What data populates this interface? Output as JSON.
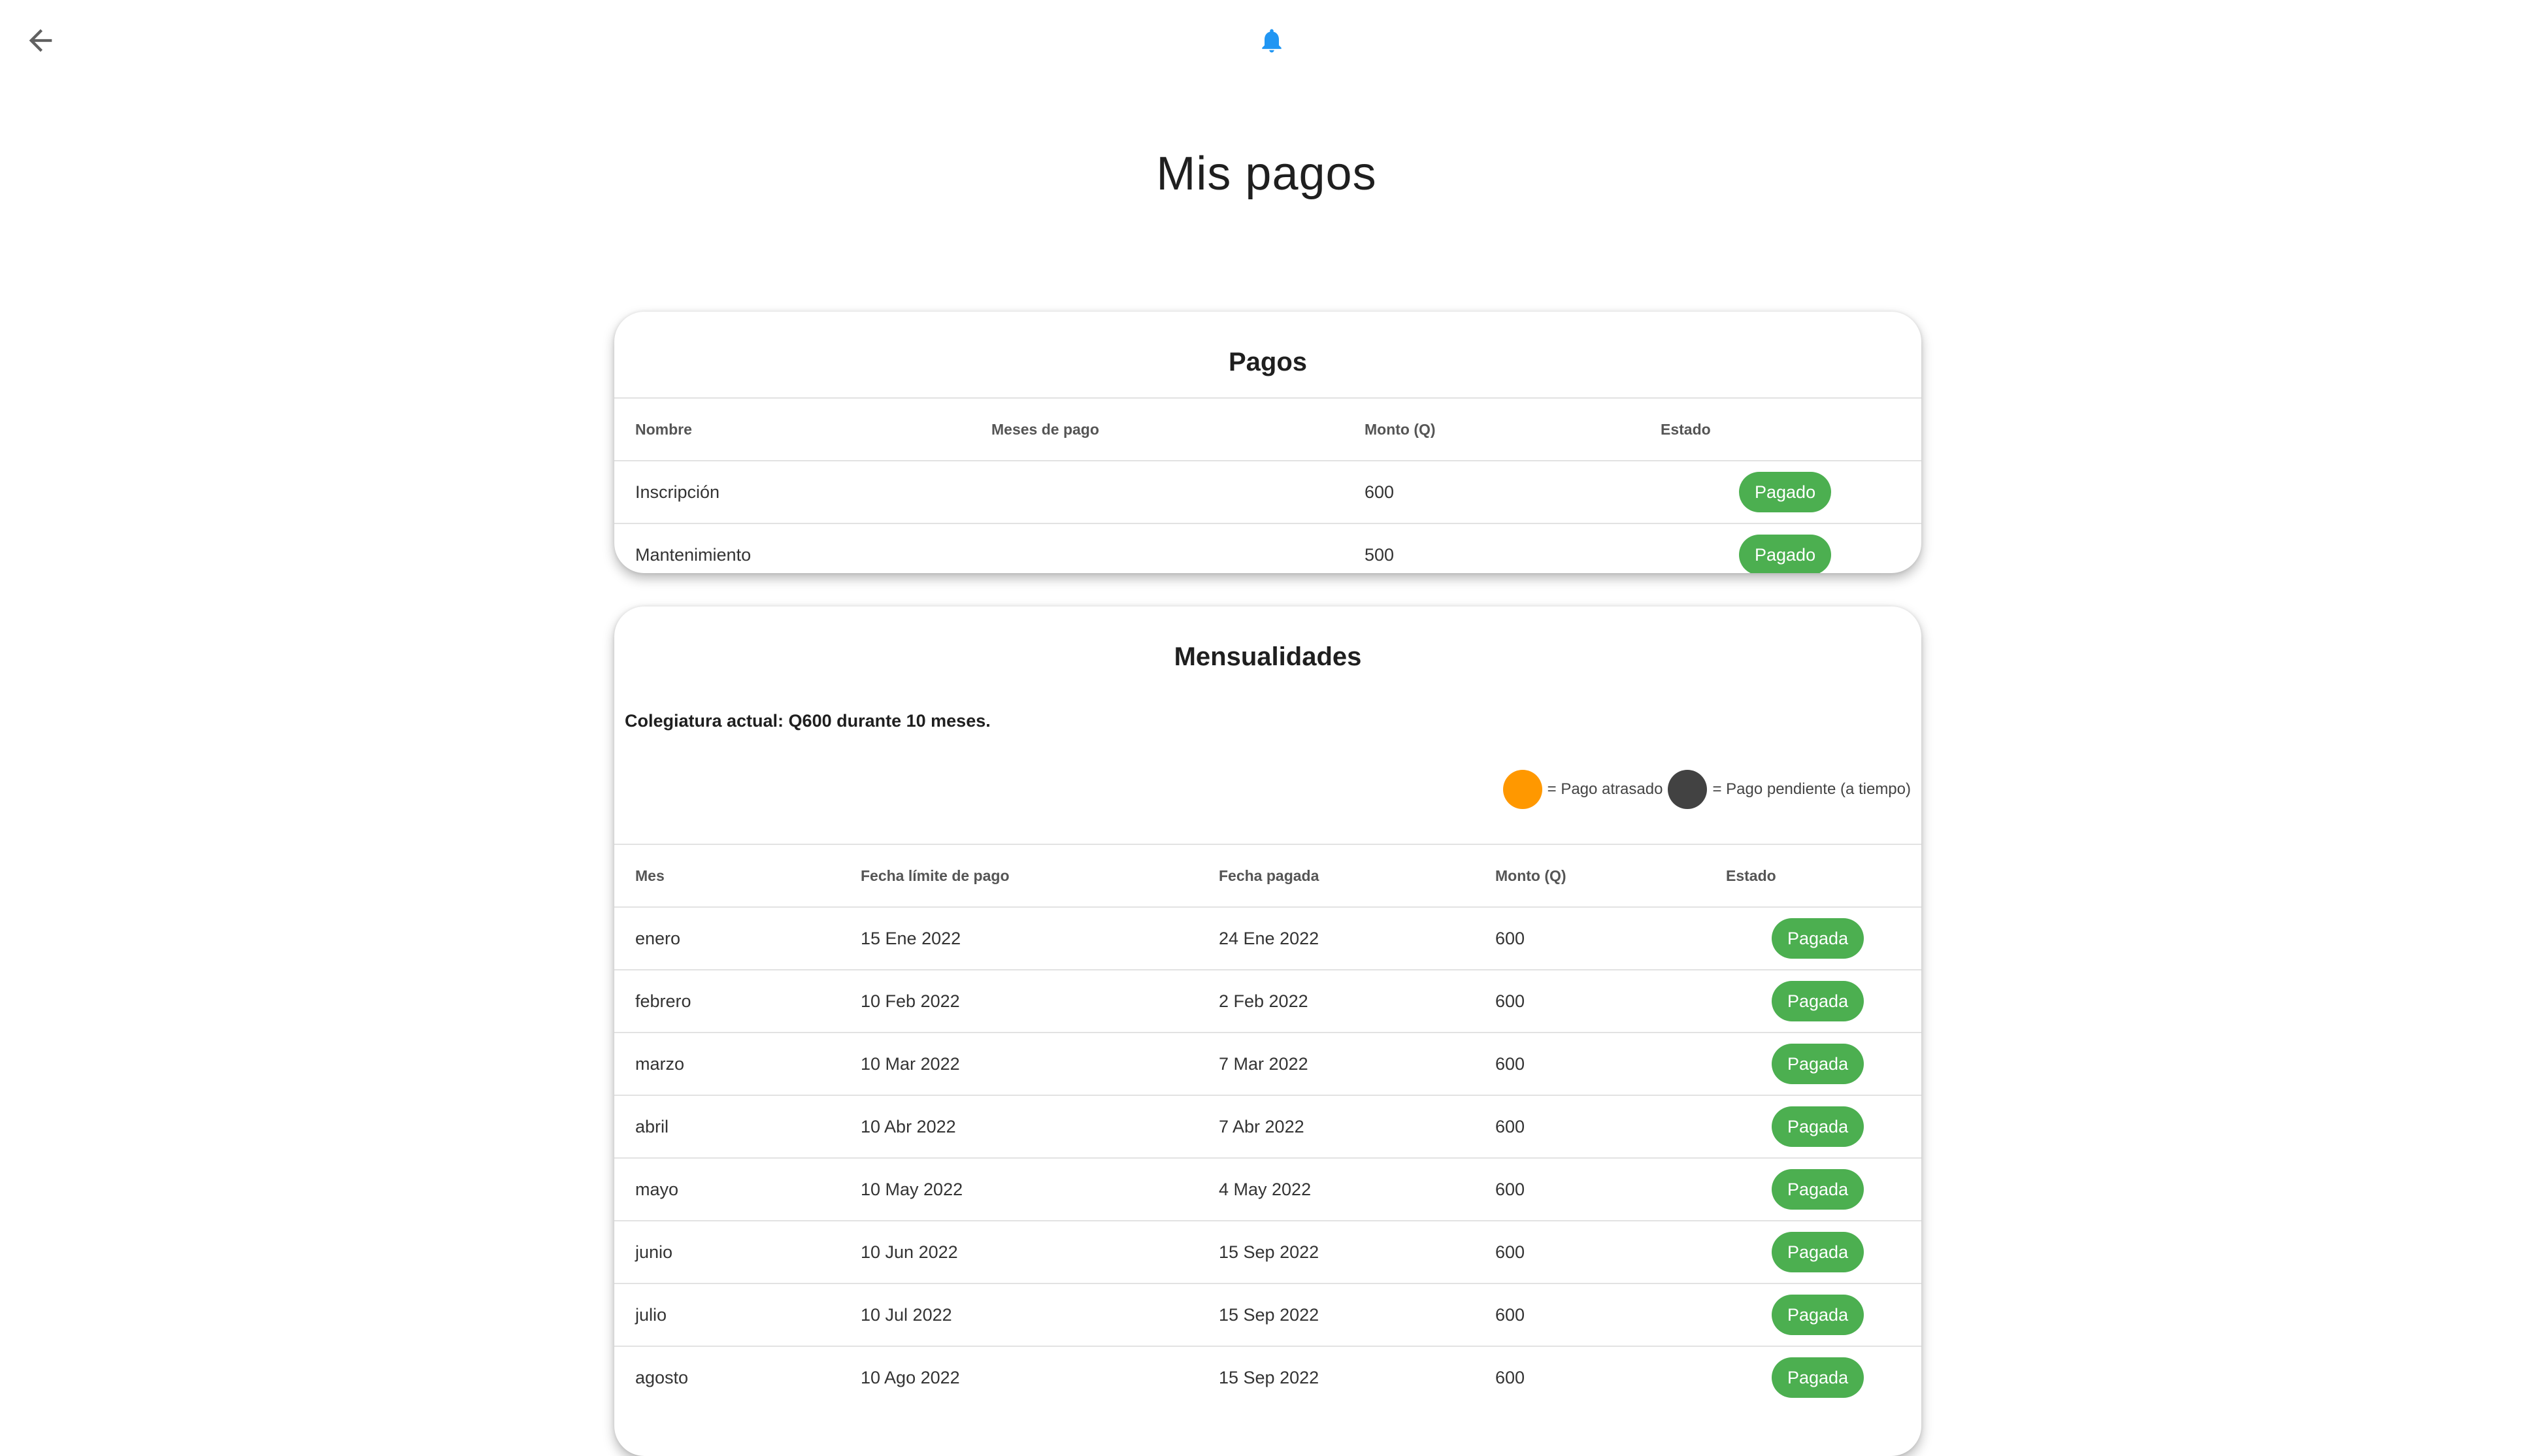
{
  "page": {
    "title": "Mis pagos"
  },
  "colors": {
    "accent": "#2196f3",
    "paid": "#4caf50",
    "late": "#ff9800",
    "pending": "#424242"
  },
  "pagos": {
    "title": "Pagos",
    "headers": [
      "Nombre",
      "Meses de pago",
      "Monto (Q)",
      "Estado"
    ],
    "rows": [
      {
        "nombre": "Inscripción",
        "meses": "",
        "monto": "600",
        "estado": "Pagado"
      },
      {
        "nombre": "Mantenimiento",
        "meses": "",
        "monto": "500",
        "estado": "Pagado"
      }
    ]
  },
  "mensualidades": {
    "title": "Mensualidades",
    "subtitle": "Colegiatura actual: Q600 durante 10 meses.",
    "legend": {
      "late": "= Pago atrasado",
      "pending": "= Pago pendiente (a tiempo)"
    },
    "headers": [
      "Mes",
      "Fecha límite de pago",
      "Fecha pagada",
      "Monto (Q)",
      "Estado"
    ],
    "rows": [
      {
        "mes": "enero",
        "limite": "15 Ene 2022",
        "pagada": "24 Ene 2022",
        "monto": "600",
        "estado": "Pagada"
      },
      {
        "mes": "febrero",
        "limite": "10 Feb 2022",
        "pagada": "2 Feb 2022",
        "monto": "600",
        "estado": "Pagada"
      },
      {
        "mes": "marzo",
        "limite": "10 Mar 2022",
        "pagada": "7 Mar 2022",
        "monto": "600",
        "estado": "Pagada"
      },
      {
        "mes": "abril",
        "limite": "10 Abr 2022",
        "pagada": "7 Abr 2022",
        "monto": "600",
        "estado": "Pagada"
      },
      {
        "mes": "mayo",
        "limite": "10 May 2022",
        "pagada": "4 May 2022",
        "monto": "600",
        "estado": "Pagada"
      },
      {
        "mes": "junio",
        "limite": "10 Jun 2022",
        "pagada": "15 Sep 2022",
        "monto": "600",
        "estado": "Pagada"
      },
      {
        "mes": "julio",
        "limite": "10 Jul 2022",
        "pagada": "15 Sep 2022",
        "monto": "600",
        "estado": "Pagada"
      },
      {
        "mes": "agosto",
        "limite": "10 Ago 2022",
        "pagada": "15 Sep 2022",
        "monto": "600",
        "estado": "Pagada"
      }
    ]
  }
}
